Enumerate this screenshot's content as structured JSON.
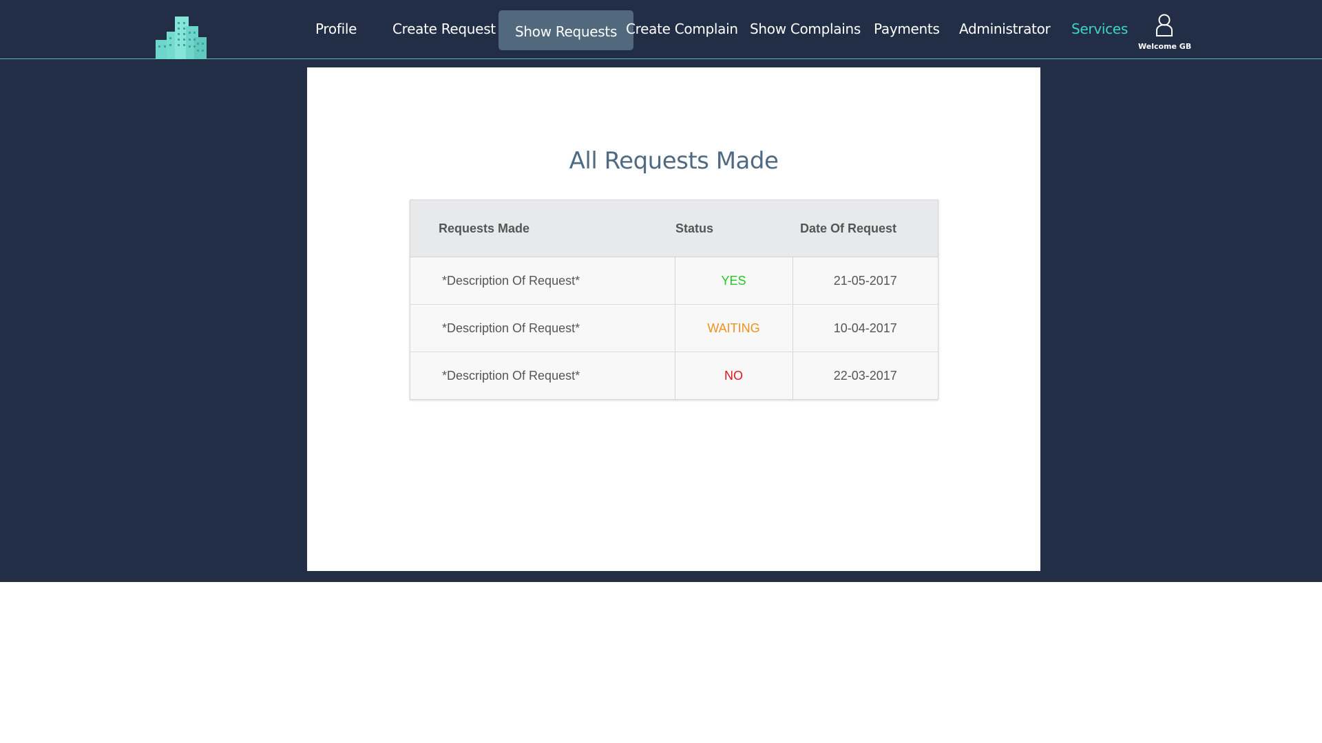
{
  "nav": {
    "items": [
      {
        "label": "Profile"
      },
      {
        "label": "Create Request"
      },
      {
        "label": "Show Requests"
      },
      {
        "label": "Create Complain"
      },
      {
        "label": "Show Complains"
      },
      {
        "label": "Payments"
      },
      {
        "label": "Administrator"
      },
      {
        "label": "Services"
      }
    ],
    "active": "Show Requests",
    "user_icon": "user-icon",
    "welcome": "Welcome GB",
    "logo_icon": "buildings-logo-icon"
  },
  "main": {
    "title": "All Requests Made",
    "table": {
      "headers": [
        "Requests Made",
        "Status",
        "Date Of Request"
      ],
      "rows": [
        {
          "description": "*Description Of Request*",
          "status": "YES",
          "date": "21-05-2017"
        },
        {
          "description": "*Description Of Request*",
          "status": "WAITING",
          "date": "10-04-2017"
        },
        {
          "description": "*Description Of Request*",
          "status": "NO",
          "date": "22-03-2017"
        }
      ]
    }
  },
  "colors": {
    "background": "#222e45",
    "active_tab": "#52697d",
    "accent": "#3fd3c9",
    "title": "#4f6a82",
    "status_yes": "#22c922",
    "status_waiting": "#f0901e",
    "status_no": "#e0141e"
  }
}
